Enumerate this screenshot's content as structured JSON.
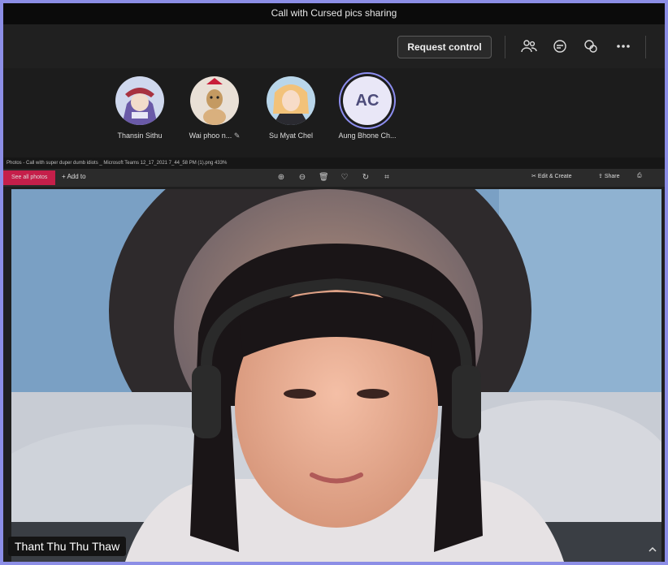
{
  "window": {
    "title": "Call with Cursed pics sharing"
  },
  "toolbar": {
    "request_control_label": "Request control"
  },
  "participants": [
    {
      "name": "Thansin Sithu"
    },
    {
      "name": "Wai phoo n..."
    },
    {
      "name": "Su Myat Chel"
    },
    {
      "name": "Aung Bhone Ch...",
      "initials": "AC"
    }
  ],
  "shared_screen": {
    "window_title": "Photos - Call with super duper dumb idiots _ Microsoft Teams 12_17_2021 7_44_58 PM (1).png  433%",
    "see_all_label": "See all photos",
    "add_to_label": "Add to",
    "edit_create_label": "Edit & Create",
    "share_label": "Share"
  },
  "video": {
    "speaker_name": "Thant Thu Thu Thaw"
  },
  "colors": {
    "accent": "#8d8ef0",
    "frame": "#8c8ee6",
    "photos_accent": "#c51f4a"
  }
}
